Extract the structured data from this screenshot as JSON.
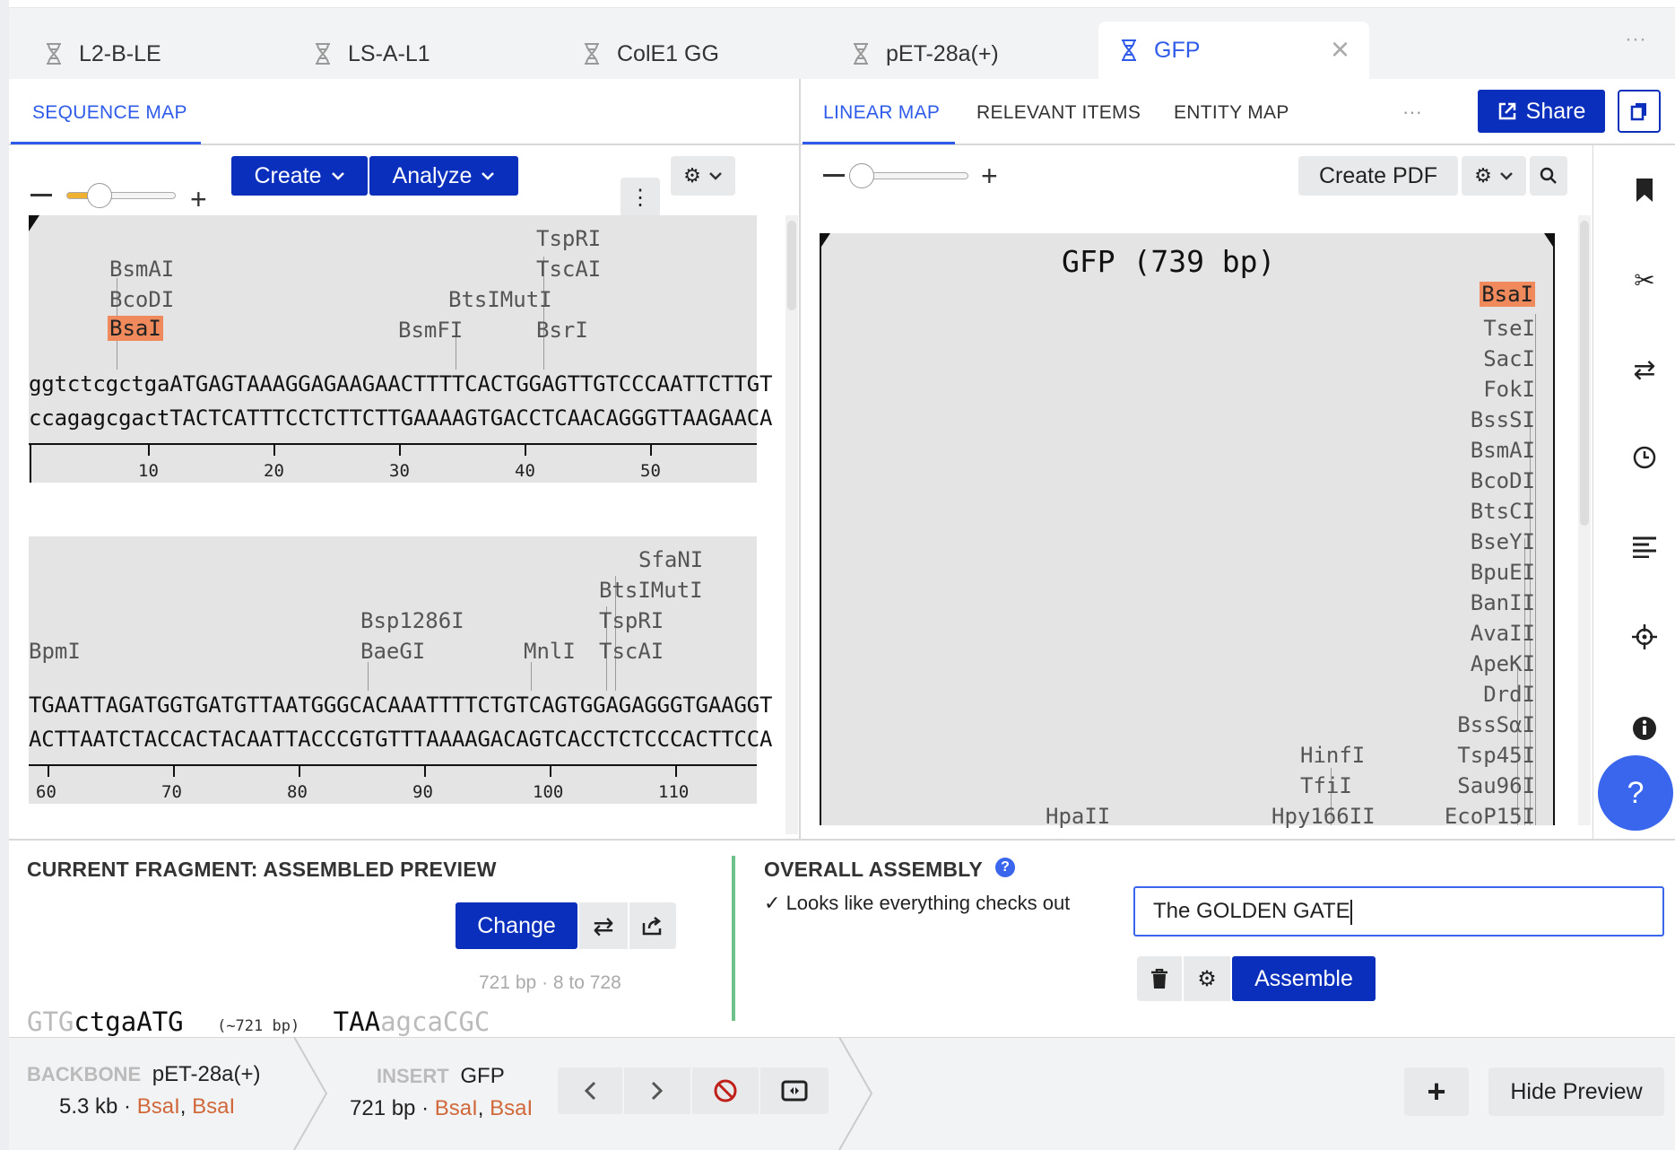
{
  "tabs": [
    {
      "label": "L2-B-LE",
      "icon": "dna-icon"
    },
    {
      "label": "LS-A-L1",
      "icon": "dna-icon"
    },
    {
      "label": "ColE1 GG",
      "icon": "dna-icon"
    },
    {
      "label": "pET-28a(+)",
      "icon": "dna-icon"
    },
    {
      "label": "GFP",
      "icon": "dna-icon"
    }
  ],
  "tabbar_more": "···",
  "left_panel": {
    "tab_label": "SEQUENCE MAP",
    "create_label": "Create",
    "analyze_label": "Analyze",
    "row1": {
      "enzymes": [
        "TspRI",
        "TscAI",
        "BsmAI",
        "BcoDI",
        "BtsIMutI",
        "BsaI",
        "BsmFI",
        "BsrI"
      ],
      "top_strand": "ggtctcgctgaATGAGTAAAGGAGAAGAACTTTTCACTGGAGTTGTCCCAATTCTTGT",
      "bottom_strand": "ccagagcgactTACTCATTTCCTCTTCTTGAAAAGTGACCTCAACAGGGTTAAGAACA",
      "ticks": [
        "10",
        "20",
        "30",
        "40",
        "50"
      ]
    },
    "row2": {
      "enzymes": [
        "SfaNI",
        "BtsIMutI",
        "Bsp1286I",
        "TspRI",
        "BpmI",
        "BaeGI",
        "MnlI",
        "TscAI"
      ],
      "top_strand": "TGAATTAGATGGTGATGTTAATGGGCACAAATTTTCTGTCAGTGGAGAGGGTGAAGGT",
      "bottom_strand": "ACTTAATCTACCACTACAATTACCCGTGTTTAAAAGACAGTCACCTCTCCCACTTCCA",
      "ticks": [
        "60",
        "70",
        "80",
        "90",
        "100",
        "110"
      ]
    }
  },
  "right_panel": {
    "tabs": [
      "LINEAR MAP",
      "RELEVANT ITEMS",
      "ENTITY MAP"
    ],
    "more": "···",
    "share_label": "Share",
    "create_pdf_label": "Create PDF",
    "map_title": "GFP (739 bp)",
    "enzymes_right": [
      "BsaI",
      "TseI",
      "SacI",
      "FokI",
      "BssSI",
      "BsmAI",
      "BcoDI",
      "BtsCI",
      "BseYI",
      "BpuEI",
      "BanII",
      "AvaII",
      "ApeKI",
      "DrdI",
      "BssSαI",
      "Tsp45I",
      "Sau96I",
      "EcoP15I"
    ],
    "enzymes_mid": [
      "HinfI",
      "TfiI",
      "Hpy166II"
    ],
    "enzymes_low": [
      "HpaII"
    ]
  },
  "fragment": {
    "title": "CURRENT FRAGMENT: ASSEMBLED PREVIEW",
    "change_label": "Change",
    "info": "721 bp · 8 to 728",
    "seq_left_grey": "GTG",
    "seq_left": "ctgaATG",
    "seq_mid": "(~721 bp)",
    "seq_right": "TAA",
    "seq_right_grey": "agcaCGC"
  },
  "assembly": {
    "title": "OVERALL ASSEMBLY",
    "status": "Looks like everything checks out",
    "name_value": "The GOLDEN GATE",
    "assemble_label": "Assemble"
  },
  "footer": {
    "backbone_label": "BACKBONE",
    "backbone_name": "pET-28a(+)",
    "backbone_size": "5.3 kb",
    "backbone_enz1": "BsaI",
    "backbone_enz2": "BsaI",
    "insert_label": "INSERT",
    "insert_name": "GFP",
    "insert_size": "721 bp",
    "insert_enz1": "BsaI",
    "insert_enz2": "BsaI",
    "hide_preview_label": "Hide Preview"
  },
  "help_label": "?",
  "colors": {
    "accent": "#2f5bea",
    "primary_button": "#0b2fbd",
    "highlight": "#f08a5d",
    "enzyme_link": "#d0683a",
    "divider_green": "#6cc38a"
  }
}
